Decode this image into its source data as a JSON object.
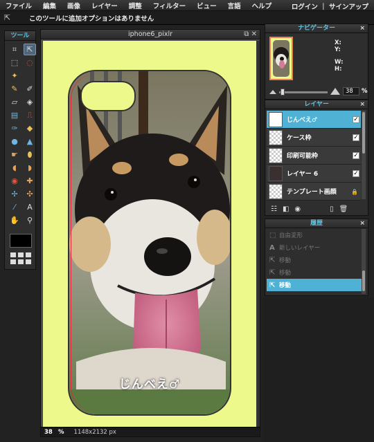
{
  "menubar": {
    "items": [
      "ファイル",
      "編集",
      "画像",
      "レイヤー",
      "調整",
      "フィルター",
      "ビュー",
      "言語",
      "ヘルプ"
    ],
    "auth_text": "ログイン ｜ サインアップ"
  },
  "options": {
    "message": "このツールに追加オプションはありません"
  },
  "tools": {
    "title": "ツール",
    "items": [
      {
        "name": "crop-tool-icon",
        "glyph": "⌗"
      },
      {
        "name": "move-tool-icon",
        "glyph": "⇱",
        "selected": true
      },
      {
        "name": "marquee-tool-icon",
        "glyph": "⬚"
      },
      {
        "name": "lasso-tool-icon",
        "glyph": "◌"
      },
      {
        "name": "magic-wand-tool-icon",
        "glyph": "✦"
      },
      {
        "name": "blank",
        "glyph": ""
      },
      {
        "name": "pencil-tool-icon",
        "glyph": "✎"
      },
      {
        "name": "brush-tool-icon",
        "glyph": "✐"
      },
      {
        "name": "eraser-tool-icon",
        "glyph": "▱"
      },
      {
        "name": "paint-bucket-tool-icon",
        "glyph": "◈"
      },
      {
        "name": "gradient-tool-icon",
        "glyph": "▤"
      },
      {
        "name": "clone-stamp-tool-icon",
        "glyph": "⎍"
      },
      {
        "name": "color-replace-tool-icon",
        "glyph": "✑"
      },
      {
        "name": "drawing-tool-icon",
        "glyph": "◆"
      },
      {
        "name": "blur-tool-icon",
        "glyph": "●"
      },
      {
        "name": "sharpen-tool-icon",
        "glyph": "▲"
      },
      {
        "name": "smudge-tool-icon",
        "glyph": "☛"
      },
      {
        "name": "sponge-tool-icon",
        "glyph": "⬮"
      },
      {
        "name": "dodge-tool-icon",
        "glyph": "◖"
      },
      {
        "name": "burn-tool-icon",
        "glyph": "◗"
      },
      {
        "name": "red-eye-tool-icon",
        "glyph": "◉"
      },
      {
        "name": "spot-heal-tool-icon",
        "glyph": "✚"
      },
      {
        "name": "bloat-tool-icon",
        "glyph": "✢"
      },
      {
        "name": "pinch-tool-icon",
        "glyph": "✣"
      },
      {
        "name": "color-picker-tool-icon",
        "glyph": "⁄"
      },
      {
        "name": "type-tool-icon",
        "glyph": "A"
      },
      {
        "name": "hand-tool-icon",
        "glyph": "✋"
      },
      {
        "name": "zoom-tool-icon",
        "glyph": "⚲"
      }
    ]
  },
  "document": {
    "title": "iphone6_pixlr",
    "caption": "じんべえ♂",
    "zoom": "38",
    "zoom_unit": "%",
    "dimensions": "1148x2132 px"
  },
  "navigator": {
    "title": "ナビゲーター",
    "x_label": "X:",
    "y_label": "Y:",
    "w_label": "W:",
    "h_label": "H:",
    "zoom": "38",
    "zoom_unit": "%"
  },
  "layers": {
    "title": "レイヤー",
    "items": [
      {
        "label": "じんべえ♂",
        "thumb": "white",
        "visible": true,
        "active": true
      },
      {
        "label": "ケース枠",
        "thumb": "checker",
        "visible": true
      },
      {
        "label": "印刷可能枠",
        "thumb": "checker",
        "visible": true
      },
      {
        "label": "レイヤー 6",
        "thumb": "dog",
        "visible": true
      },
      {
        "label": "テンプレート画顔",
        "thumb": "checker",
        "locked": true
      }
    ]
  },
  "history": {
    "title": "履歴",
    "items": [
      {
        "label": "自由変形",
        "icon": "transform-icon"
      },
      {
        "label": "新しいレイヤー",
        "icon": "type-icon"
      },
      {
        "label": "移動",
        "icon": "move-icon"
      },
      {
        "label": "移動",
        "icon": "move-icon"
      },
      {
        "label": "移動",
        "icon": "move-icon",
        "active": true
      }
    ]
  },
  "colors": {
    "accent": "#4fb1d3",
    "canvas_bg": "#eef98c",
    "title_text": "#5fc3e0"
  }
}
